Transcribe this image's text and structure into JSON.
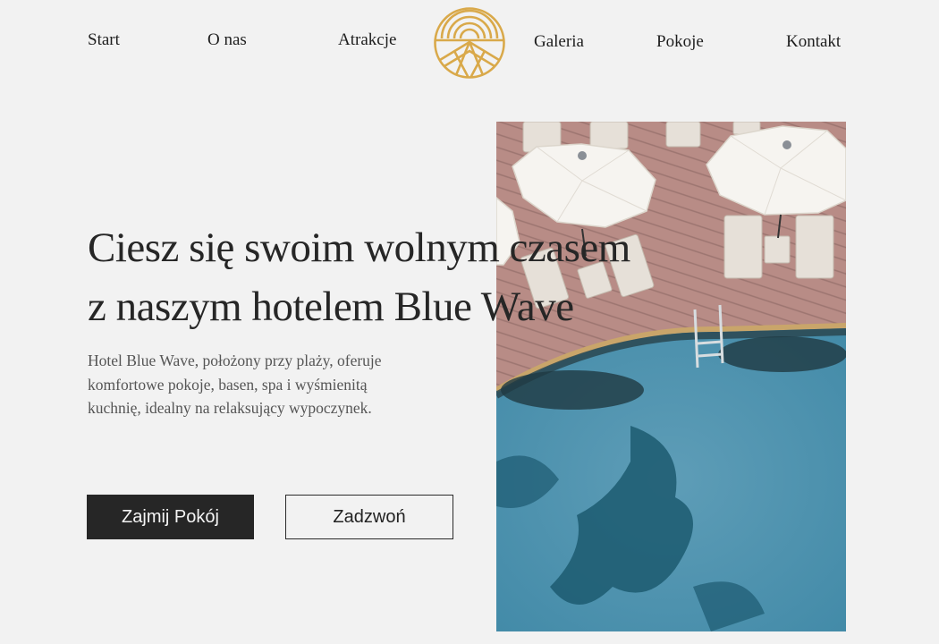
{
  "nav": {
    "items": [
      {
        "label": "Start"
      },
      {
        "label": "O nas"
      },
      {
        "label": "Atrakcje"
      },
      {
        "label": "Galeria"
      },
      {
        "label": "Pokoje"
      },
      {
        "label": "Kontakt"
      }
    ]
  },
  "logo": {
    "icon": "sun-over-mountain-logo",
    "color": "#d9a94a"
  },
  "hero": {
    "headline_line1": "Ciesz się swoim wolnym czasem",
    "headline_line2": "z naszym hotelem Blue Wave",
    "description": "Hotel Blue Wave, położony przy plaży, oferuje komfortowe pokoje, basen, spa i wyśmienitą kuchnię, idealny na relaksujący wypoczynek.",
    "primary_button": "Zajmij Pokój",
    "secondary_button": "Zadzwoń",
    "image": "pool-with-umbrellas-photo"
  },
  "colors": {
    "background": "#f2f2f2",
    "dark": "#262626",
    "accent": "#d9a94a",
    "pool": "#4a8fac",
    "deck": "#b98a83"
  }
}
